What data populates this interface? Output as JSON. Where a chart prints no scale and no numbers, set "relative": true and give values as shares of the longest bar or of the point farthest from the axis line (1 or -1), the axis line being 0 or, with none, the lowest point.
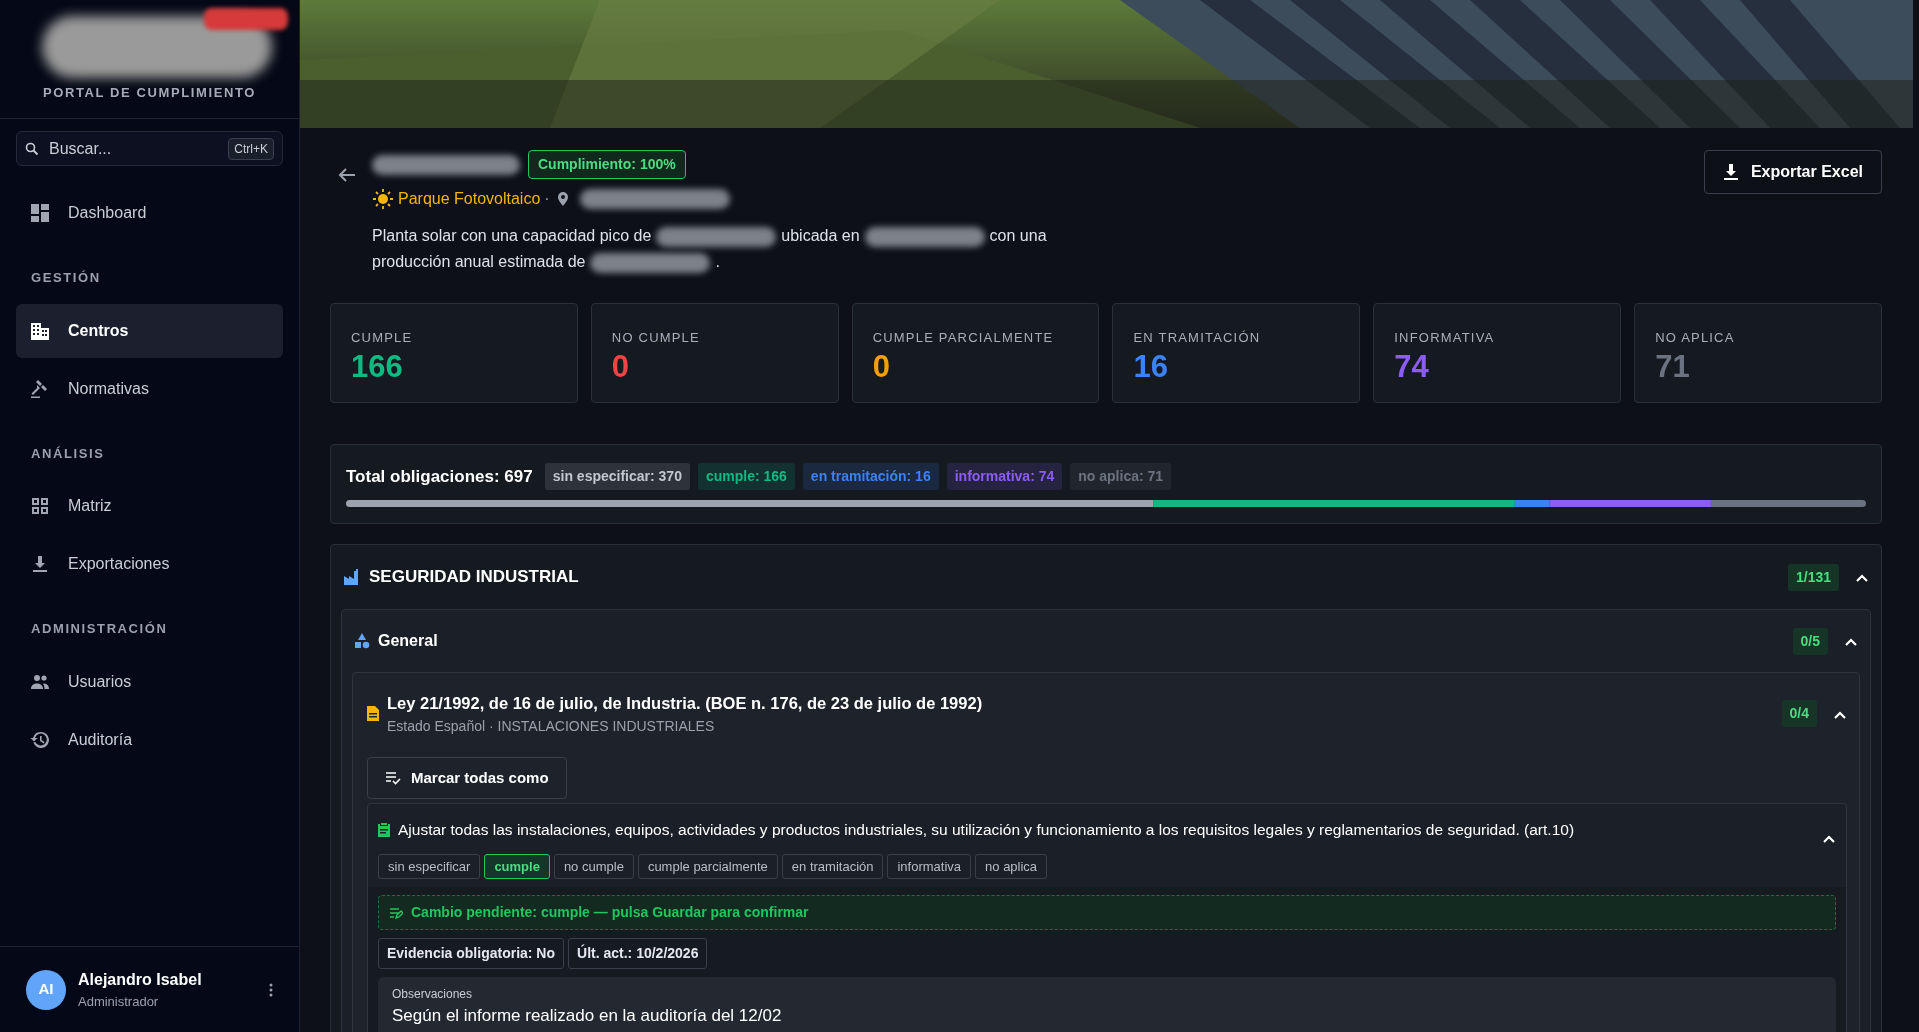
{
  "sidebar": {
    "logo_redacted": true,
    "subtitle": "PORTAL DE CUMPLIMIENTO",
    "search": {
      "placeholder": "Buscar...",
      "shortcut": "Ctrl+K"
    },
    "groups": [
      {
        "items": [
          {
            "label": "Dashboard",
            "selected": false
          }
        ]
      },
      {
        "heading": "GESTIÓN",
        "items": [
          {
            "label": "Centros",
            "selected": true
          },
          {
            "label": "Normativas",
            "selected": false
          }
        ]
      },
      {
        "heading": "ANÁLISIS",
        "items": [
          {
            "label": "Matriz",
            "selected": false
          },
          {
            "label": "Exportaciones",
            "selected": false
          }
        ]
      },
      {
        "heading": "ADMINISTRACIÓN",
        "items": [
          {
            "label": "Usuarios",
            "selected": false
          },
          {
            "label": "Auditoría",
            "selected": false
          }
        ]
      }
    ],
    "user": {
      "initials": "AI",
      "name": "Alejandro Isabel",
      "role": "Administrador"
    }
  },
  "header": {
    "title_redacted": true,
    "badge": "Cumplimiento: 100%",
    "type": "Parque Fotovoltaico",
    "separator": "·",
    "location_redacted": true,
    "description": [
      {
        "kind": "text",
        "text": "Planta solar con una capacidad pico de"
      },
      {
        "kind": "redacted"
      },
      {
        "kind": "text",
        "text": "ubicada en"
      },
      {
        "kind": "redacted"
      },
      {
        "kind": "text",
        "text": "con una"
      },
      {
        "kind": "text",
        "text": "producción anual estimada de"
      },
      {
        "kind": "redacted"
      },
      {
        "kind": "text",
        "text": "."
      }
    ],
    "export_button": "Exportar Excel"
  },
  "stats": [
    {
      "label": "CUMPLE",
      "value": "166",
      "color": "#10b981"
    },
    {
      "label": "NO CUMPLE",
      "value": "0",
      "color": "#ef4444"
    },
    {
      "label": "CUMPLE PARCIALMENTE",
      "value": "0",
      "color": "#f59e0b"
    },
    {
      "label": "EN TRAMITACIÓN",
      "value": "16",
      "color": "#3b82f6"
    },
    {
      "label": "INFORMATIVA",
      "value": "74",
      "color": "#8b5cf6"
    },
    {
      "label": "NO APLICA",
      "value": "71",
      "color": "#6b7280"
    }
  ],
  "totals": {
    "label": "Total obligaciones: 697",
    "chips": [
      "sin especificar: 370",
      "cumple: 166",
      "en tramitación: 16",
      "informativa: 74",
      "no aplica: 71"
    ],
    "chart_data": {
      "type": "bar",
      "orientation": "horizontal",
      "stacked": true,
      "relative": true,
      "series": [
        {
          "color": "#9ca3af",
          "values": [
            0.531
          ]
        },
        {
          "color": "#10b981",
          "values": [
            0.238
          ]
        },
        {
          "color": "#3b82f6",
          "values": [
            0.023
          ]
        },
        {
          "color": "#8b5cf6",
          "values": [
            0.106
          ]
        },
        {
          "color": "#6b7280",
          "values": [
            0.102
          ]
        }
      ]
    }
  },
  "section": {
    "title": "SEGURIDAD INDUSTRIAL",
    "count": "1/131",
    "expanded": true,
    "group": {
      "title": "General",
      "count": "0/5",
      "expanded": true,
      "law": {
        "title": "Ley 21/1992, de 16 de julio, de Industria. (BOE n. 176, de 23 de julio de 1992)",
        "subtitle": "Estado Español · INSTALACIONES INDUSTRIALES",
        "count": "0/4",
        "expanded": true,
        "bulk_button": "Marcar todas como",
        "obligation": {
          "text": "Ajustar todas las instalaciones, equipos, actividades y productos industriales, su utilización y funcionamiento a los requisitos legales y reglamentarios de seguridad. (art.10)",
          "expanded": true,
          "statuses": [
            {
              "label": "sin especificar",
              "selected": false
            },
            {
              "label": "cumple",
              "selected": true
            },
            {
              "label": "no cumple",
              "selected": false
            },
            {
              "label": "cumple parcialmente",
              "selected": false
            },
            {
              "label": "en tramitación",
              "selected": false
            },
            {
              "label": "informativa",
              "selected": false
            },
            {
              "label": "no aplica",
              "selected": false
            }
          ],
          "pending": "Cambio pendiente: cumple — pulsa Guardar para confirmar",
          "meta": [
            "Evidencia obligatoria: No",
            "Últ. act.: 10/2/2026"
          ],
          "notes": {
            "label": "Observaciones",
            "value": "Según el informe realizado en la auditoría del 12/02"
          }
        }
      }
    }
  }
}
